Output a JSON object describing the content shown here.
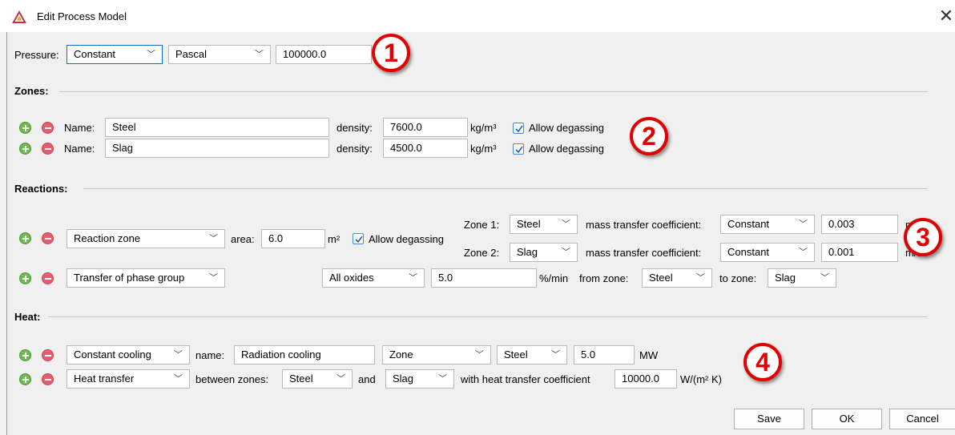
{
  "window": {
    "title": "Edit Process Model",
    "close_glyph": "✕"
  },
  "pressure": {
    "label": "Pressure:",
    "mode": "Constant",
    "unit": "Pascal",
    "value": "100000.0"
  },
  "zones": {
    "heading": "Zones:",
    "items": [
      {
        "name_label": "Name:",
        "name": "Steel",
        "density_label": "density:",
        "density": "7600.0",
        "unit": "kg/m³",
        "degas_label": "Allow degassing",
        "degas": true
      },
      {
        "name_label": "Name:",
        "name": "Slag",
        "density_label": "density:",
        "density": "4500.0",
        "unit": "kg/m³",
        "degas_label": "Allow degassing",
        "degas": true
      }
    ]
  },
  "reactions": {
    "heading": "Reactions:",
    "reaction_zone": {
      "type": "Reaction zone",
      "area_label": "area:",
      "area": "6.0",
      "area_unit": "m²",
      "degas_label": "Allow degassing",
      "degas": true,
      "zone_rows": [
        {
          "label": "Zone 1:",
          "zone": "Steel",
          "mtc_label": "mass transfer coefficient:",
          "mtc_mode": "Constant",
          "value": "0.003",
          "unit": "m/s"
        },
        {
          "label": "Zone 2:",
          "zone": "Slag",
          "mtc_label": "mass transfer coefficient:",
          "mtc_mode": "Constant",
          "value": "0.001",
          "unit": "m/s"
        }
      ]
    },
    "transfer": {
      "type": "Transfer of phase group",
      "group": "All oxides",
      "rate": "5.0",
      "rate_unit": "%/min",
      "from_label": "from zone:",
      "from": "Steel",
      "to_label": "to zone:",
      "to": "Slag"
    }
  },
  "heat": {
    "heading": "Heat:",
    "cooling": {
      "type": "Constant cooling",
      "name_label": "name:",
      "name": "Radiation cooling",
      "scope": "Zone",
      "zone": "Steel",
      "value": "5.0",
      "unit": "MW"
    },
    "transfer": {
      "type": "Heat transfer",
      "between_label": "between zones:",
      "zone_a": "Steel",
      "and_label": "and",
      "zone_b": "Slag",
      "htc_label": "with heat transfer coefficient",
      "value": "10000.0",
      "unit": "W/(m² K)"
    }
  },
  "buttons": {
    "save": "Save",
    "ok": "OK",
    "cancel": "Cancel"
  },
  "badges": [
    "1",
    "2",
    "3",
    "4"
  ],
  "colors": {
    "badge": "#e00000",
    "focus": "#0a6fd0",
    "add": "#6dba4e",
    "remove": "#e06070"
  }
}
